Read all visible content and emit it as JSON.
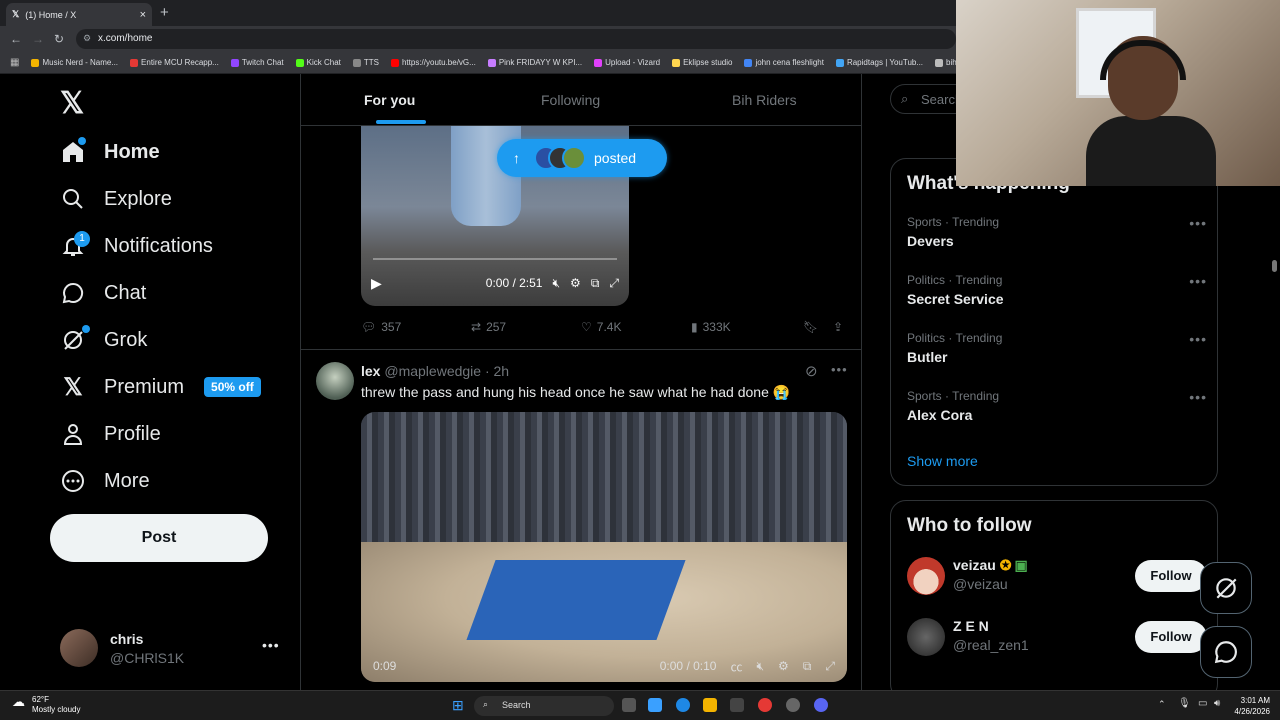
{
  "browser": {
    "tab_title": "(1) Home / X",
    "url": "x.com/home",
    "bookmarks": [
      "Music Nerd - Name...",
      "Entire MCU Recapp...",
      "Twitch Chat",
      "Kick Chat",
      "TTS",
      "https://youtu.be/vG...",
      "Pink FRIDAYY W KPI...",
      "Upload - Vizard",
      "Eklipse studio",
      "john cena fleshlight",
      "Rapidtags | YouTub...",
      "bih links"
    ],
    "bookmark_colors": [
      "#f4b400",
      "#e53935",
      "#9146ff",
      "#53fc18",
      "#888888",
      "#ff0000",
      "#c77dff",
      "#e040fb",
      "#ffd54f",
      "#4285f4",
      "#42a5f5",
      "#bbbbbb"
    ]
  },
  "nav": {
    "home": "Home",
    "explore": "Explore",
    "notifications": "Notifications",
    "notifications_count": "1",
    "chat": "Chat",
    "grok": "Grok",
    "premium": "Premium",
    "premium_badge": "50% off",
    "profile": "Profile",
    "more": "More",
    "post": "Post",
    "account_name": "chris",
    "account_handle": "@CHRlS1K"
  },
  "feed": {
    "tabs": [
      "For you",
      "Following",
      "Bih Riders"
    ],
    "active_tab": "For you",
    "posted_pill": "posted",
    "video1_time": "0:00 / 2:51",
    "stats": {
      "replies": "357",
      "reposts": "257",
      "likes": "7.4K",
      "views": "333K"
    },
    "tweet2": {
      "name": "lex",
      "handle": "@maplewedgie",
      "age": "· 2h",
      "text": "threw the pass and hung his head once he saw what he had done 😭",
      "video_left_time": "0:09",
      "video_time": "0:00 / 0:10"
    }
  },
  "right": {
    "search_placeholder": "Search",
    "whats_happening": "What's happening",
    "trends": [
      {
        "meta": "Sports · Trending",
        "name": "Devers"
      },
      {
        "meta": "Politics · Trending",
        "name": "Secret Service"
      },
      {
        "meta": "Politics · Trending",
        "name": "Butler"
      },
      {
        "meta": "Sports · Trending",
        "name": "Alex Cora"
      }
    ],
    "show_more": "Show more",
    "who_to_follow": "Who to follow",
    "follow_suggestions": [
      {
        "name": "veizau",
        "handle": "@veizau",
        "button": "Follow"
      },
      {
        "name": "Z E N",
        "handle": "@real_zen1",
        "button": "Follow"
      }
    ]
  },
  "taskbar": {
    "weather_temp": "62°F",
    "weather_desc": "Mostly cloudy",
    "search": "Search",
    "time": "3:01 AM",
    "date": "4/26/2026"
  },
  "accent": "#1d9bf0"
}
